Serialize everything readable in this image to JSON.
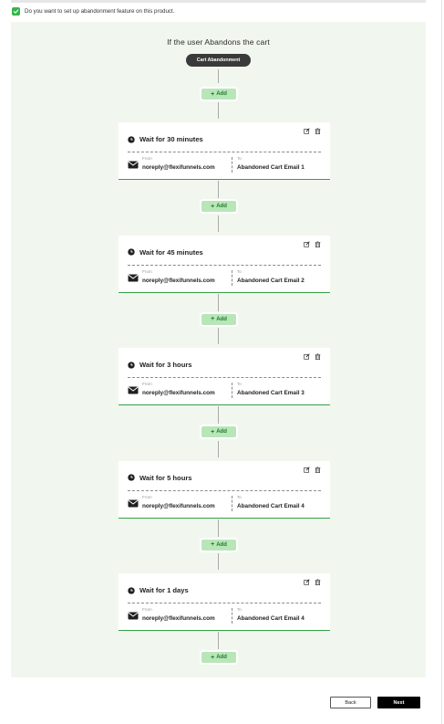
{
  "consent": {
    "label": "Do you want to set up abandonment feature on this product.",
    "checked": true
  },
  "flow": {
    "title": "If the user Abandons the cart",
    "trigger_label": "Cart Abandonment",
    "add_label": "Add",
    "from_caption": "From",
    "to_caption": "To",
    "steps": [
      {
        "wait": "Wait for 30 minutes",
        "from": "noreply@flexifunnels.com",
        "to": "Abandoned Cart Email 1"
      },
      {
        "wait": "Wait for 45 minutes",
        "from": "noreply@flexifunnels.com",
        "to": "Abandoned Cart Email 2"
      },
      {
        "wait": "Wait for 3 hours",
        "from": "noreply@flexifunnels.com",
        "to": "Abandoned Cart Email 3"
      },
      {
        "wait": "Wait for 5 hours",
        "from": "noreply@flexifunnels.com",
        "to": "Abandoned Cart Email 4"
      },
      {
        "wait": "Wait for 1 days",
        "from": "noreply@flexifunnels.com",
        "to": "Abandoned Cart Email 4"
      }
    ]
  },
  "footer": {
    "back_label": "Back",
    "next_label": "Next"
  },
  "colors": {
    "panel_bg": "#f1f7ef",
    "accent_green": "#35a046",
    "add_bg": "#b8e6b8",
    "dark": "#3a3a3a"
  },
  "icons": {
    "checkbox": "check-icon",
    "wait": "clock-icon",
    "edit": "edit-icon",
    "delete": "trash-icon",
    "email": "mail-icon",
    "add": "plus-icon"
  }
}
